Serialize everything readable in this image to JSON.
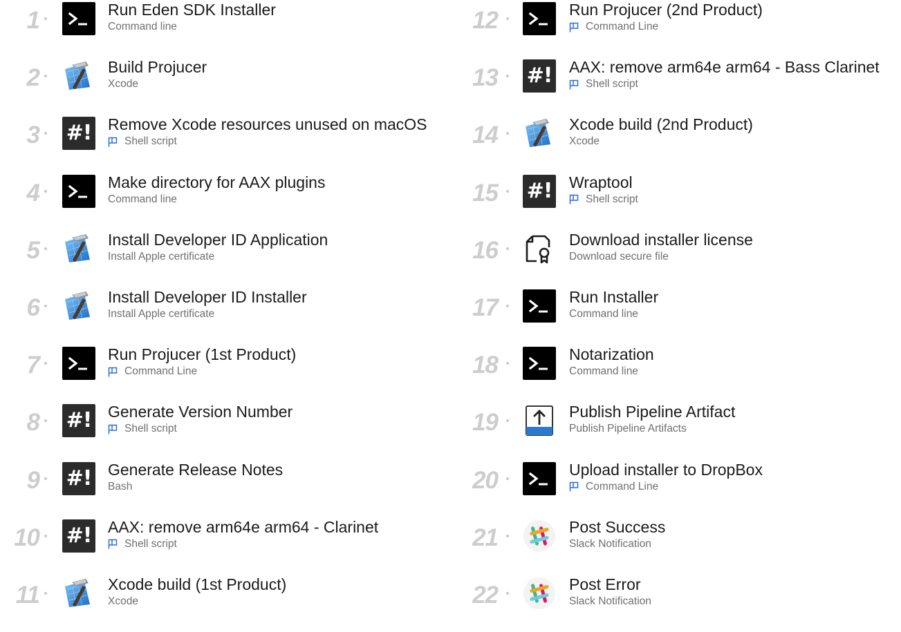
{
  "icons": {
    "command-line": "terminal-icon",
    "shell-script": "shell-icon",
    "xcode": "xcode-hammer-icon",
    "secure-file": "certificate-file-icon",
    "publish": "upload-icon",
    "slack": "slack-icon"
  },
  "left_steps": [
    {
      "num": "1",
      "title": "Run Eden SDK Installer",
      "sub": "Command line",
      "icon": "cmd",
      "flag": false
    },
    {
      "num": "2",
      "title": "Build Projucer",
      "sub": "Xcode",
      "icon": "xcode",
      "flag": false
    },
    {
      "num": "3",
      "title": "Remove Xcode resources unused on macOS",
      "sub": "Shell script",
      "icon": "shell",
      "flag": true
    },
    {
      "num": "4",
      "title": "Make directory for AAX plugins",
      "sub": "Command line",
      "icon": "cmd",
      "flag": false
    },
    {
      "num": "5",
      "title": "Install Developer ID Application",
      "sub": "Install Apple certificate",
      "icon": "xcode",
      "flag": false
    },
    {
      "num": "6",
      "title": "Install Developer ID Installer",
      "sub": "Install Apple certificate",
      "icon": "xcode",
      "flag": false
    },
    {
      "num": "7",
      "title": "Run Projucer (1st Product)",
      "sub": "Command Line",
      "icon": "cmd",
      "flag": true
    },
    {
      "num": "8",
      "title": "Generate Version Number",
      "sub": "Shell script",
      "icon": "shell",
      "flag": true
    },
    {
      "num": "9",
      "title": "Generate Release Notes",
      "sub": "Bash",
      "icon": "shell",
      "flag": false
    },
    {
      "num": "10",
      "title": "AAX: remove arm64e arm64 - Clarinet",
      "sub": "Shell script",
      "icon": "shell",
      "flag": true
    },
    {
      "num": "11",
      "title": "Xcode build (1st Product)",
      "sub": "Xcode",
      "icon": "xcode",
      "flag": false
    }
  ],
  "right_steps": [
    {
      "num": "12",
      "title": "Run Projucer (2nd Product)",
      "sub": "Command Line",
      "icon": "cmd",
      "flag": true
    },
    {
      "num": "13",
      "title": "AAX: remove arm64e arm64 - Bass Clarinet",
      "sub": "Shell script",
      "icon": "shell",
      "flag": true
    },
    {
      "num": "14",
      "title": "Xcode build (2nd Product)",
      "sub": "Xcode",
      "icon": "xcode",
      "flag": false
    },
    {
      "num": "15",
      "title": "Wraptool",
      "sub": "Shell script",
      "icon": "shell",
      "flag": true
    },
    {
      "num": "16",
      "title": "Download installer license",
      "sub": "Download secure file",
      "icon": "file",
      "flag": false
    },
    {
      "num": "17",
      "title": "Run Installer",
      "sub": "Command line",
      "icon": "cmd",
      "flag": false
    },
    {
      "num": "18",
      "title": "Notarization",
      "sub": "Command line",
      "icon": "cmd",
      "flag": false
    },
    {
      "num": "19",
      "title": "Publish Pipeline Artifact",
      "sub": "Publish Pipeline Artifacts",
      "icon": "publish",
      "flag": false
    },
    {
      "num": "20",
      "title": "Upload installer to DropBox",
      "sub": "Command Line",
      "icon": "cmd",
      "flag": true
    },
    {
      "num": "21",
      "title": "Post Success",
      "sub": "Slack Notification",
      "icon": "slack",
      "flag": false
    },
    {
      "num": "22",
      "title": "Post Error",
      "sub": "Slack Notification",
      "icon": "slack",
      "flag": false
    }
  ],
  "shell_glyph": "#!",
  "colors": {
    "number": "#cdcdcd",
    "title": "#1a1a1a",
    "subtitle": "#6f6f6f",
    "flag": "#2a6fd6"
  }
}
